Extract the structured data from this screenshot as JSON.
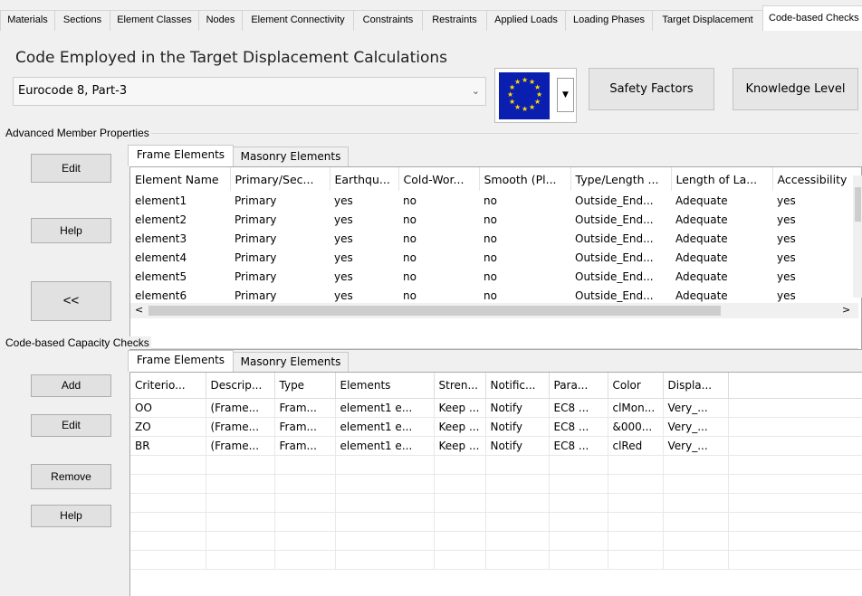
{
  "top_tabs": [
    {
      "label": "Materials"
    },
    {
      "label": "Sections"
    },
    {
      "label": "Element Classes"
    },
    {
      "label": "Nodes"
    },
    {
      "label": "Element Connectivity"
    },
    {
      "label": "Constraints"
    },
    {
      "label": "Restraints"
    },
    {
      "label": "Applied Loads"
    },
    {
      "label": "Loading Phases"
    },
    {
      "label": "Target Displacement"
    },
    {
      "label": "Code-based Checks"
    }
  ],
  "code_section": {
    "title": "Code Employed in the Target Displacement Calculations",
    "selected_code": "Eurocode 8, Part-3",
    "flag_icon": "eu-flag-icon",
    "safety_factors_label": "Safety Factors",
    "knowledge_level_label": "Knowledge Level"
  },
  "advanced": {
    "title": "Advanced Member Properties",
    "buttons": {
      "edit": "Edit",
      "help": "Help",
      "collapse": "<<"
    },
    "tabs": [
      "Frame Elements",
      "Masonry Elements"
    ],
    "columns": [
      "Element Name",
      "Primary/Sec...",
      "Earthqu...",
      "Cold-Wor...",
      "Smooth (Pl...",
      "Type/Length ...",
      "Length of La...",
      "Accessibility"
    ],
    "rows": [
      [
        "element1",
        "Primary",
        "yes",
        "no",
        "no",
        "Outside_End...",
        "Adequate",
        "yes"
      ],
      [
        "element2",
        "Primary",
        "yes",
        "no",
        "no",
        "Outside_End...",
        "Adequate",
        "yes"
      ],
      [
        "element3",
        "Primary",
        "yes",
        "no",
        "no",
        "Outside_End...",
        "Adequate",
        "yes"
      ],
      [
        "element4",
        "Primary",
        "yes",
        "no",
        "no",
        "Outside_End...",
        "Adequate",
        "yes"
      ],
      [
        "element5",
        "Primary",
        "yes",
        "no",
        "no",
        "Outside_End...",
        "Adequate",
        "yes"
      ],
      [
        "element6",
        "Primary",
        "yes",
        "no",
        "no",
        "Outside_End...",
        "Adequate",
        "yes"
      ]
    ],
    "scroll_left": "<",
    "scroll_right": ">"
  },
  "capacity": {
    "title": "Code-based Capacity Checks",
    "buttons": {
      "add": "Add",
      "edit": "Edit",
      "remove": "Remove",
      "help": "Help"
    },
    "tabs": [
      "Frame Elements",
      "Masonry Elements"
    ],
    "columns": [
      "Criterio...",
      "Descrip...",
      "Type",
      "Elements",
      "Stren...",
      "Notific...",
      "Para...",
      "Color",
      "Displa..."
    ],
    "rows": [
      [
        "OO",
        "(Frame...",
        "Fram...",
        "element1  e...",
        "Keep ...",
        "Notify",
        "EC8  ...",
        "clMon...",
        "Very_..."
      ],
      [
        "ZO",
        "(Frame...",
        "Fram...",
        "element1  e...",
        "Keep ...",
        "Notify",
        "EC8  ...",
        "&000...",
        "Very_..."
      ],
      [
        "BR",
        "(Frame...",
        "Fram...",
        "element1  e...",
        "Keep ...",
        "Notify",
        "EC8  ...",
        "clRed",
        "Very_..."
      ]
    ],
    "empty_rows": 6
  }
}
